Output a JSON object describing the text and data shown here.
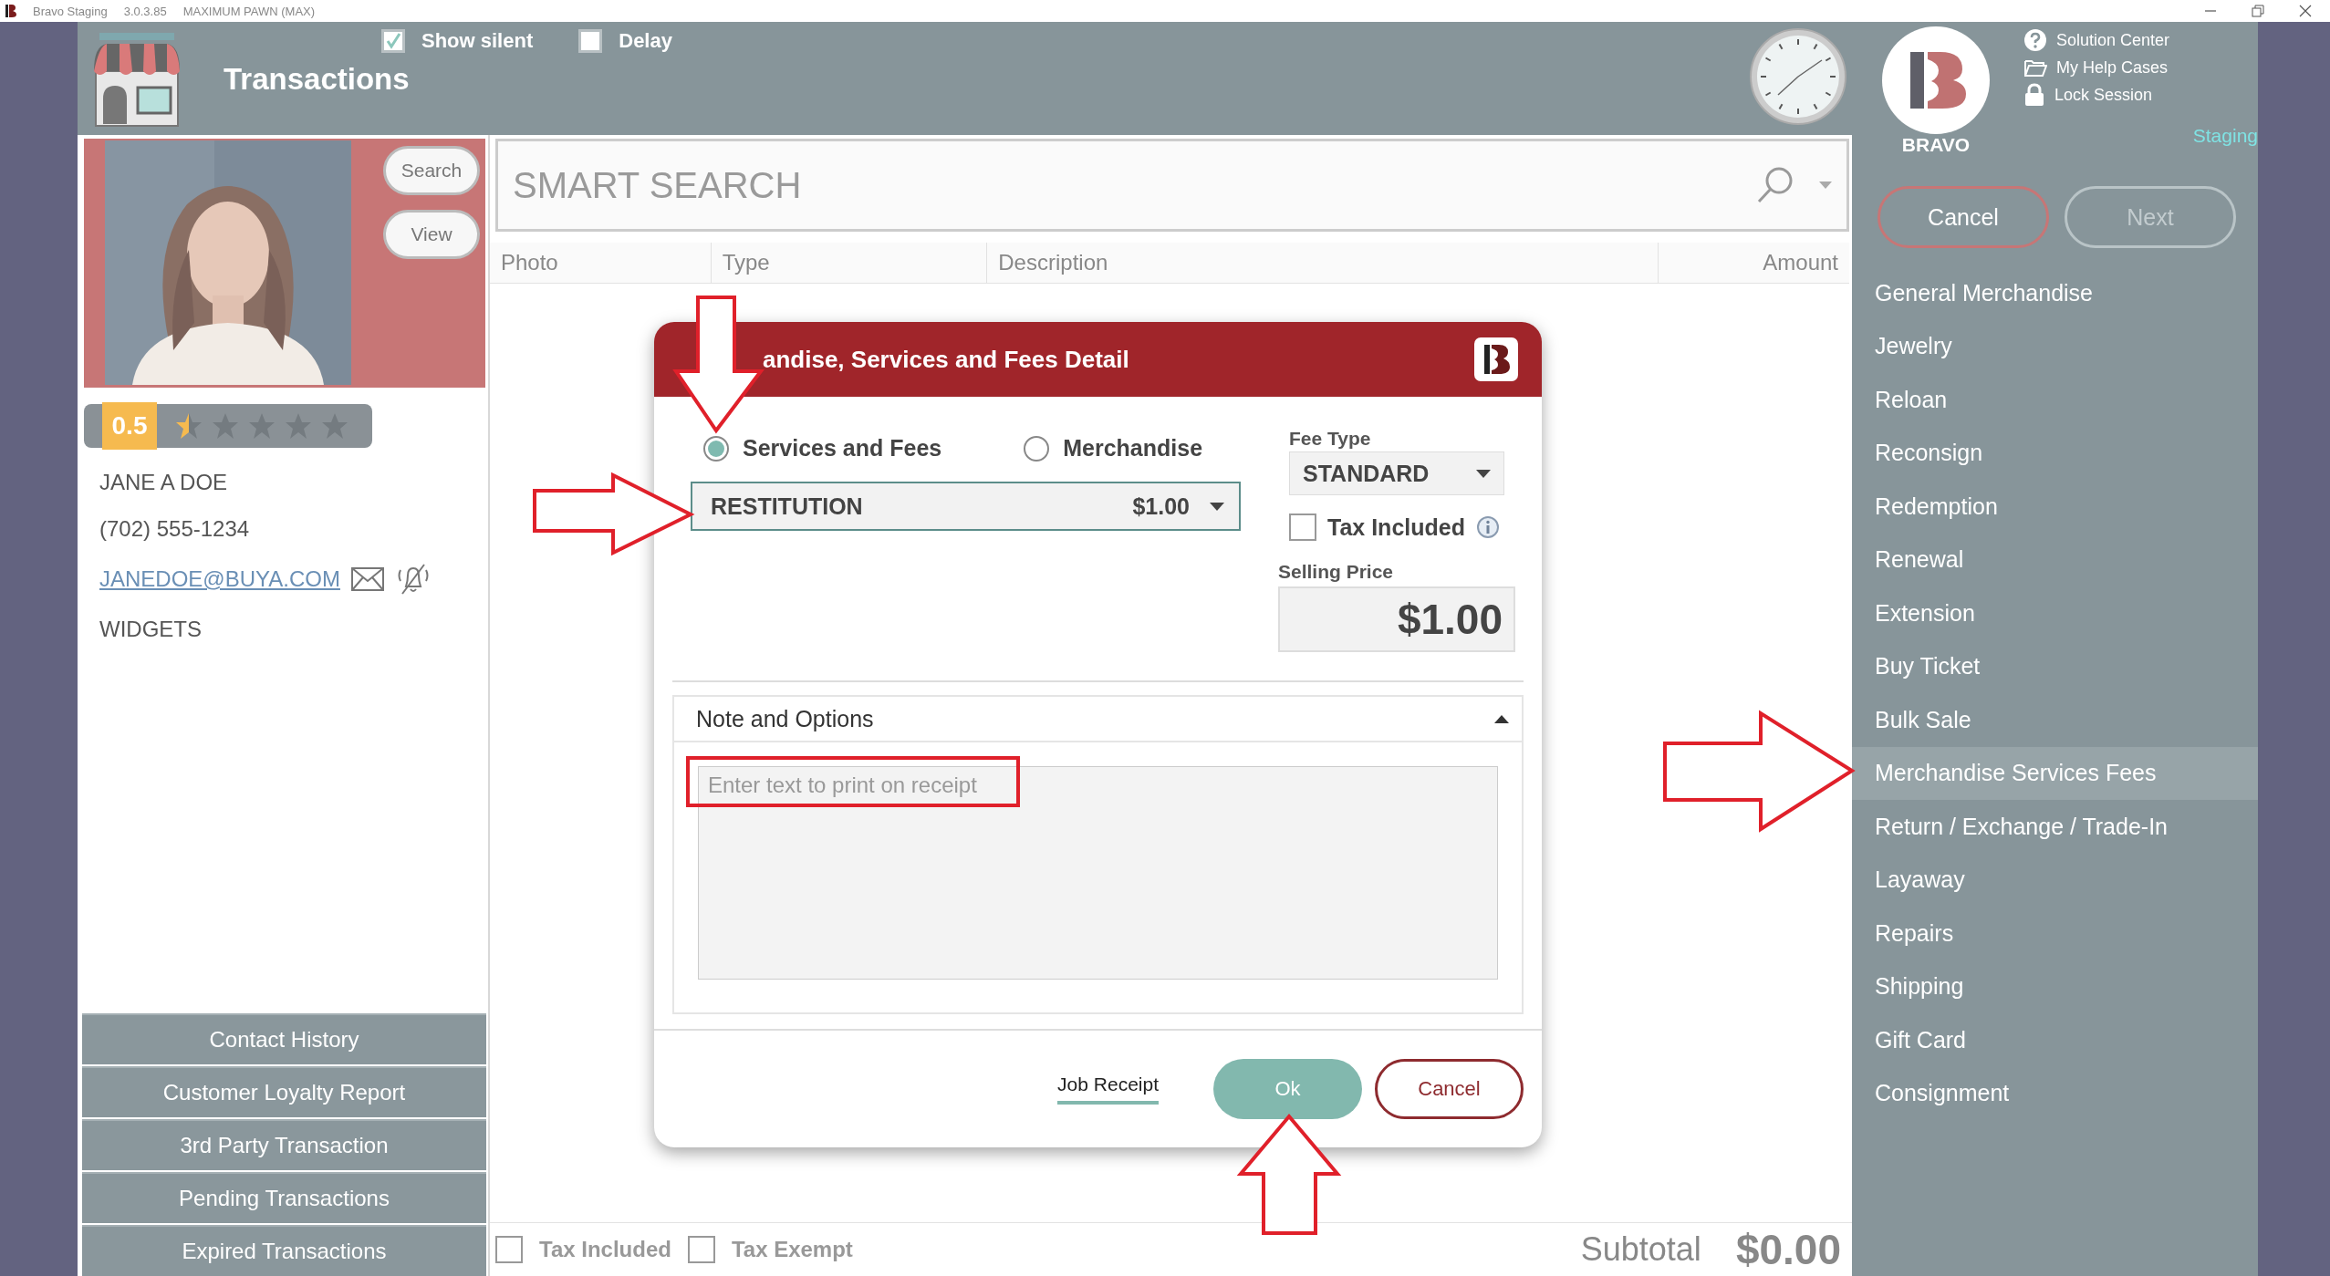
{
  "title_bar": {
    "app_name": "Bravo Staging",
    "version": "3.0.3.85",
    "store": "MAXIMUM PAWN (MAX)"
  },
  "header": {
    "title": "Transactions",
    "options": [
      {
        "label": "Show silent",
        "checked": true
      },
      {
        "label": "Delay",
        "checked": false
      }
    ],
    "brand": "BRAVO",
    "help_links": [
      {
        "label": "Solution Center",
        "kind": "help"
      },
      {
        "label": "My Help Cases",
        "kind": "folder"
      },
      {
        "label": "Lock Session",
        "kind": "lock"
      }
    ],
    "environment": "Staging"
  },
  "customer": {
    "buttons": [
      "Search",
      "View"
    ],
    "rating": "0.5",
    "stars": 0.5,
    "name": "JANE A DOE",
    "phone": "(702) 555-1234",
    "email": "JANEDOE@BUYA.COM",
    "company": "WIDGETS",
    "actions": [
      "Contact History",
      "Customer Loyalty Report",
      "3rd Party Transaction",
      "Pending Transactions",
      "Expired Transactions"
    ]
  },
  "search": {
    "placeholder": "SMART SEARCH"
  },
  "table": {
    "columns": [
      "Photo",
      "Type",
      "Description",
      "Amount"
    ]
  },
  "footer": {
    "options": [
      {
        "label": "Tax Included",
        "checked": false
      },
      {
        "label": "Tax Exempt",
        "checked": false
      }
    ],
    "subtotal_label": "Subtotal",
    "subtotal": "$0.00"
  },
  "nav_buttons": [
    {
      "label": "Cancel",
      "kind": "cancel"
    },
    {
      "label": "Next",
      "kind": "next"
    }
  ],
  "menu": [
    {
      "label": "General Merchandise",
      "selected": false
    },
    {
      "label": "Jewelry",
      "selected": false
    },
    {
      "label": "Reloan",
      "selected": false
    },
    {
      "label": "Reconsign",
      "selected": false
    },
    {
      "label": "Redemption",
      "selected": false
    },
    {
      "label": "Renewal",
      "selected": false
    },
    {
      "label": "Extension",
      "selected": false
    },
    {
      "label": "Buy Ticket",
      "selected": false
    },
    {
      "label": "Bulk Sale",
      "selected": false
    },
    {
      "label": "Merchandise Services Fees",
      "selected": true
    },
    {
      "label": "Return / Exchange / Trade-In",
      "selected": false
    },
    {
      "label": "Layaway",
      "selected": false
    },
    {
      "label": "Repairs",
      "selected": false
    },
    {
      "label": "Shipping",
      "selected": false
    },
    {
      "label": "Gift Card",
      "selected": false
    },
    {
      "label": "Consignment",
      "selected": false
    }
  ],
  "dialog": {
    "title": "andise, Services and Fees Detail",
    "modes": [
      {
        "label": "Services and Fees",
        "selected": true
      },
      {
        "label": "Merchandise",
        "selected": false
      }
    ],
    "item": {
      "value": "RESTITUTION",
      "price": "$1.00"
    },
    "fee_type_label": "Fee Type",
    "fee_type": "STANDARD",
    "tax_included": {
      "label": "Tax Included",
      "checked": false
    },
    "selling_price_label": "Selling Price",
    "selling_price": "$1.00",
    "notes": {
      "title": "Note and Options",
      "expanded": true,
      "placeholder": "Enter text to print on receipt"
    },
    "link": "Job Receipt",
    "buttons": [
      {
        "label": "Ok",
        "kind": "primary"
      },
      {
        "label": "Cancel",
        "kind": "secondary"
      }
    ]
  }
}
